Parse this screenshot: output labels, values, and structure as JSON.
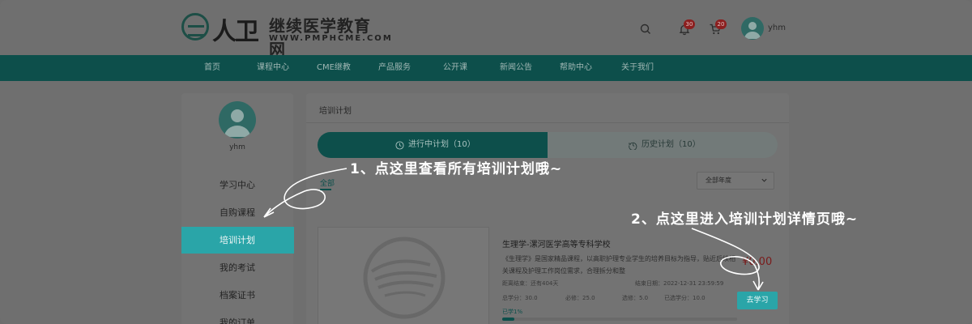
{
  "header": {
    "brand_mark": "人卫",
    "brand_name": "继续医学教育网",
    "brand_url": "WWW.PMPHCME.COM",
    "icons": [
      "search-icon",
      "bell-icon",
      "cart-icon"
    ],
    "notification_count": "30",
    "cart_count": "20",
    "username": "yhm"
  },
  "nav": {
    "items": [
      "首页",
      "课程中心",
      "CME继教",
      "产品服务",
      "公开课",
      "新闻公告",
      "帮助中心",
      "关于我们"
    ]
  },
  "sidebar": {
    "username": "yhm",
    "items": [
      {
        "label": "学习中心",
        "active": false
      },
      {
        "label": "自购课程",
        "active": false
      },
      {
        "label": "培训计划",
        "active": true
      },
      {
        "label": "我的考试",
        "active": false
      },
      {
        "label": "档案证书",
        "active": false
      },
      {
        "label": "我的订单",
        "active": false
      }
    ]
  },
  "main": {
    "title": "培训计划",
    "tabs": [
      {
        "label": "进行中计划（10）",
        "icon": "clock-icon",
        "active": true
      },
      {
        "label": "历史计划（10）",
        "icon": "history-icon",
        "active": false
      }
    ],
    "filter_all": "全部",
    "year_select": "全部年度",
    "card": {
      "title": "生理学-漯河医学高等专科学校",
      "description": "《生理学》是国家精品课程，以高职护理专业学生的培养目标为指导，贴近后续相关课程及护理工作岗位需求，合理拆分和整",
      "price": "¥0.00",
      "deadline": "距离结束：还有404天",
      "end_date": "结束日期：2022-12-31 23:59:59",
      "credits_total": "总学分：30.0",
      "credits_required": "必修：25.0",
      "credits_elective": "选修：5.0",
      "credits_done": "已选学分：10.0",
      "progress_label": "已学1%",
      "progress_percent": 1,
      "button": "去学习"
    }
  },
  "annotations": {
    "step1": "1、点这里查看所有培训计划哦~",
    "step2": "2、点这里进入培训计划详情页哦~"
  },
  "colors": {
    "accent_teal": "#2aa5a8",
    "dark_teal": "#0d4f4b",
    "overlay": "#6f6f6f",
    "price_red": "#7a1b1b"
  }
}
